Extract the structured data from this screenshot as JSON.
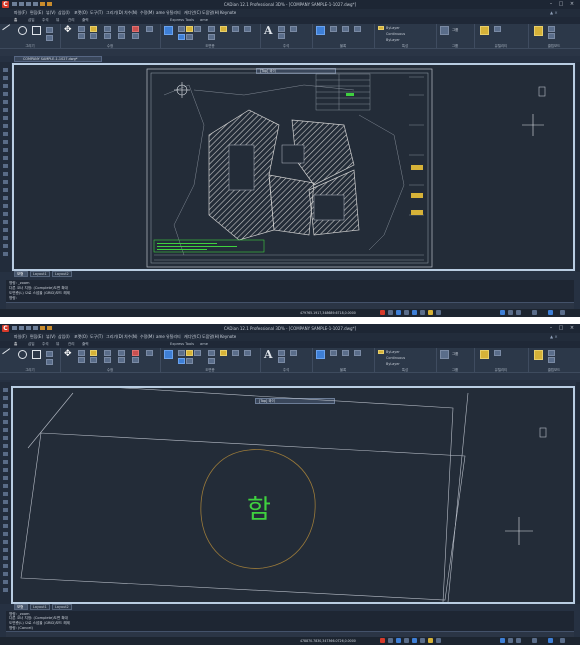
{
  "window": {
    "title": "CADian 12.1 Professional 3D% - [COMPANY SAMPLE-1-1027.dwg*]"
  },
  "quick_access": {
    "workspace": "2D"
  },
  "menu": [
    "파일(F)",
    "편집(E)",
    "뷰(V)",
    "삽입(I)",
    "포맷(O)",
    "도구(T)",
    "그리기(D)",
    "치수(N)",
    "수정(M)",
    "ame",
    "유틸리티",
    "캐디안(C)",
    "도움말(H)",
    "Express",
    "Keynote"
  ],
  "ribbon_tabs": [
    "홈",
    "삽입",
    "주석",
    "뷰",
    "관리",
    "출력",
    "Express Tools",
    "ame"
  ],
  "ribbon_panels": {
    "draw": "그리기",
    "modify": "수정",
    "layer": "도면층",
    "annotation": "주석",
    "block": "블록",
    "properties": "특성",
    "groups": "그룹",
    "utilities": "유틸리티",
    "clipboard": "클립보드"
  },
  "ribbon_text": {
    "text_big": "A",
    "layer_name": "도면층",
    "bylayer": "ByLayer",
    "continuous": "Continuous",
    "group": "그룹",
    "paste": "붙여넣기"
  },
  "document_tab": "COMPANY SAMPLE-1-1027.dwg*",
  "viewport_title": "[Top] 와이",
  "layout_tabs": [
    "모형",
    "Layout1",
    "Layout2"
  ],
  "command_history_1": [
    "명령: _zoom",
    "다른 코너 지정: (Complete)도면 확대",
    "도면층(L) 으로 스냅을 (GRID)모드 해제",
    "명령:"
  ],
  "command_history_2": [
    "명령: _zoom",
    "다른 코너 지정: (Complete)도면 확대",
    "도면층(L) 으로 스냅을 (GRID)모드 해제",
    "명령: (Cancel)"
  ],
  "status": {
    "coords_1": "479765.1917,348689.6718,0.0000",
    "coords_2": "478870.7830,347366.0726,0.0000"
  },
  "drawing": {
    "label": "함",
    "label_color": "#3fd13f",
    "circle_color": "#9a7a3a"
  },
  "colors": {
    "accent": "#d63a2a",
    "hatch": "#c7c7c7",
    "canvas": "#232c38",
    "border": "#b9cde2"
  }
}
